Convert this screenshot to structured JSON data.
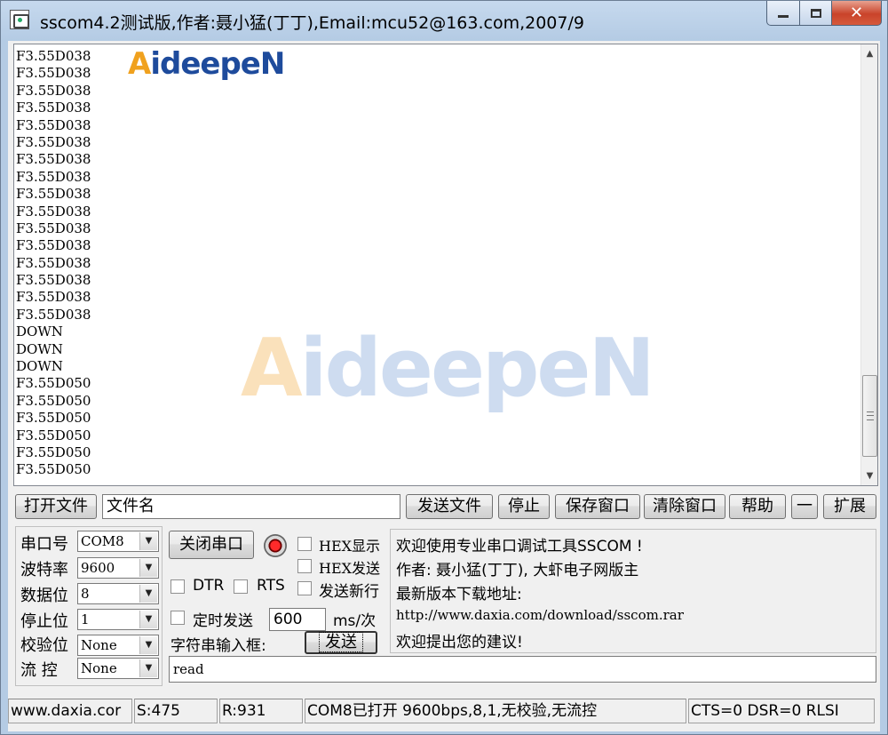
{
  "window": {
    "title": "sscom4.2测试版,作者:聂小猛(丁丁),Email:mcu52@163.com,2007/9",
    "buttons": {
      "minimize": "minimize",
      "maximize": "maximize",
      "close": "✕"
    }
  },
  "watermark": {
    "text_a": "A",
    "text_rest": "ideepeN"
  },
  "receive": {
    "lines": [
      "F3.55D038",
      "F3.55D038",
      "F3.55D038",
      "F3.55D038",
      "F3.55D038",
      "F3.55D038",
      "F3.55D038",
      "F3.55D038",
      "F3.55D038",
      "F3.55D038",
      "F3.55D038",
      "F3.55D038",
      "F3.55D038",
      "F3.55D038",
      "F3.55D038",
      "F3.55D038",
      "DOWN",
      "DOWN",
      "DOWN",
      "F3.55D050",
      "F3.55D050",
      "F3.55D050",
      "F3.55D050",
      "F3.55D050",
      "F3.55D050"
    ]
  },
  "file_row": {
    "open_file": "打开文件",
    "file_name": "文件名",
    "send_file": "发送文件",
    "stop": "停止",
    "save_window": "保存窗口",
    "clear_window": "清除窗口",
    "help": "帮助",
    "minus": "一",
    "expand": "扩展"
  },
  "port_settings": {
    "port_label": "串口号",
    "port_value": "COM8",
    "baud_label": "波特率",
    "baud_value": "9600",
    "data_bits_label": "数据位",
    "data_bits_value": "8",
    "stop_bits_label": "停止位",
    "stop_bits_value": "1",
    "parity_label": "校验位",
    "parity_value": "None",
    "flow_label": "流 控",
    "flow_value": "None"
  },
  "controls": {
    "close_port": "关闭串口",
    "hex_display": "HEX显示",
    "hex_send": "HEX发送",
    "send_newline": "发送新行",
    "dtr": "DTR",
    "rts": "RTS",
    "timed_send": "定时发送",
    "interval": "600",
    "interval_unit": "ms/次",
    "string_input_label": "字符串输入框:",
    "send": "发送",
    "input_value": "read"
  },
  "info_panel": {
    "line1": "欢迎使用专业串口调试工具SSCOM !",
    "line2": "作者: 聂小猛(丁丁), 大虾电子网版主",
    "line3": "最新版本下载地址:",
    "line4": "http://www.daxia.com/download/sscom.rar",
    "line5": "欢迎提出您的建议!"
  },
  "statusbar": {
    "site": "www.daxia.cor",
    "sent": "S:475",
    "received": "R:931",
    "port_state": "COM8已打开  9600bps,8,1,无校验,无流控",
    "signals": "CTS=0 DSR=0 RLSI"
  },
  "colors": {
    "title_bg": "#b9d1ea",
    "close_red": "#c9432a",
    "led_red": "#ff2a2a",
    "logo_blue": "#1e4b9c",
    "logo_orange": "#f0a11e"
  }
}
